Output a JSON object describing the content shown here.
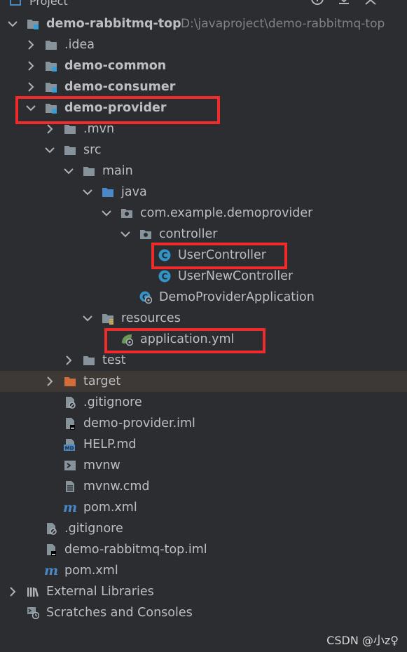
{
  "header": {
    "title": "Project"
  },
  "tree": {
    "root": {
      "name": "demo-rabbitmq-top",
      "path": "D:\\javaproject\\demo-rabbitmq-top"
    },
    "idea": ".idea",
    "common": "demo-common",
    "consumer": "demo-consumer",
    "provider": "demo-provider",
    "mvn": ".mvn",
    "src": "src",
    "main": "main",
    "java": "java",
    "package": "com.example.demoprovider",
    "controller": "controller",
    "user_controller": "UserController",
    "user_new_controller": "UserNewController",
    "app_class": "DemoProviderApplication",
    "resources": "resources",
    "app_yml": "application.yml",
    "test": "test",
    "target": "target",
    "gitignore": ".gitignore",
    "provider_iml": "demo-provider.iml",
    "help_md": "HELP.md",
    "mvnw": "mvnw",
    "mvnw_cmd": "mvnw.cmd",
    "pom": "pom.xml",
    "root_gitignore": ".gitignore",
    "root_iml": "demo-rabbitmq-top.iml",
    "root_pom": "pom.xml",
    "external_libraries": "External Libraries",
    "scratches": "Scratches and Consoles"
  },
  "icon_badges": {
    "class_letter": "C",
    "md_badge": "MD",
    "maven_m": "m"
  },
  "watermark": "CSDN @小z♀",
  "colors": {
    "highlight": "#ef2b2b",
    "folder": "#87939a",
    "source_folder": "#4a88c7",
    "target_folder": "#d26d3b",
    "class_icon": "#3592c4",
    "selected_row": "#3e3934",
    "module_badge": "#389fd6",
    "spring_leaf": "#6a9955"
  }
}
